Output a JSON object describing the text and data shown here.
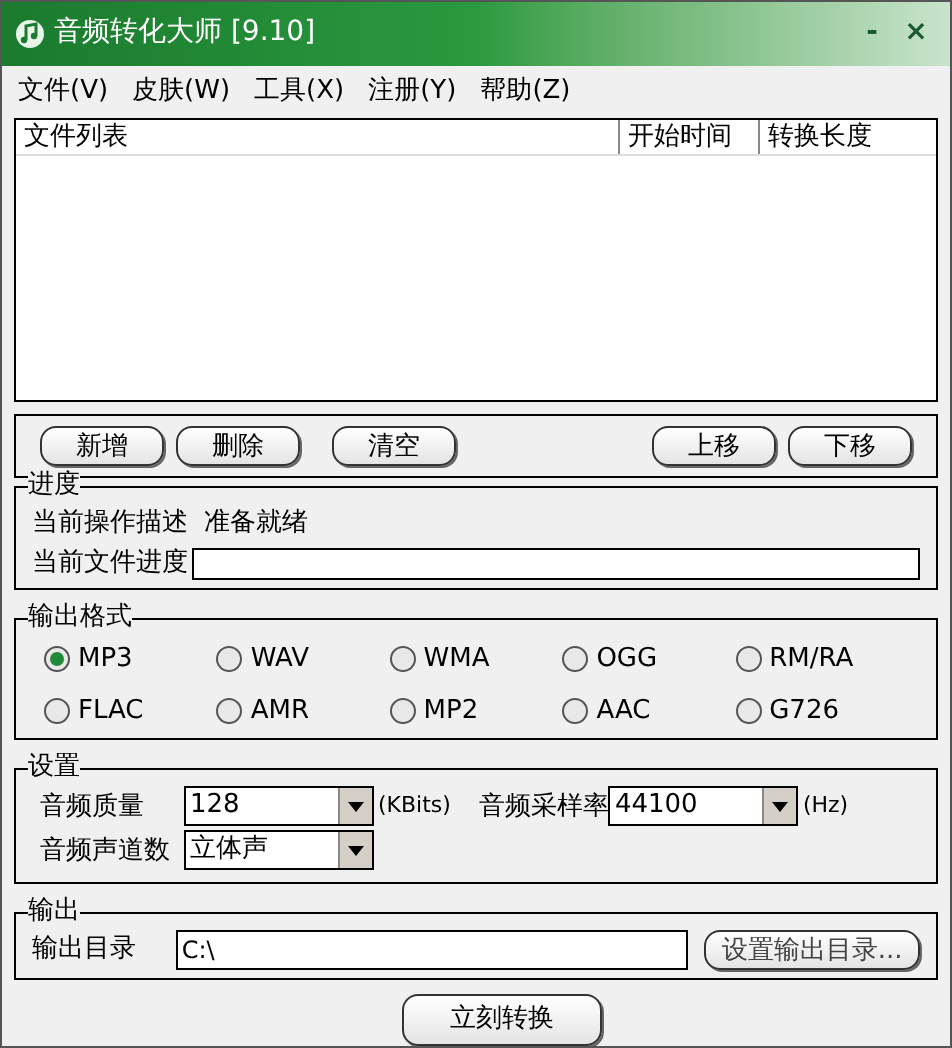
{
  "window": {
    "title": "音频转化大师 [9.10]",
    "controls": [
      "-",
      "×"
    ]
  },
  "menu": [
    "文件(V)",
    "皮肤(W)",
    "工具(X)",
    "注册(Y)",
    "帮助(Z)"
  ],
  "file_list": {
    "columns": [
      "文件列表",
      "开始时间",
      "转换长度"
    ]
  },
  "list_buttons": [
    {
      "label": "新增",
      "kind": "left"
    },
    {
      "label": "删除",
      "kind": "left"
    },
    {
      "label": "清空",
      "kind": "left"
    },
    {
      "label": "上移",
      "kind": "right"
    },
    {
      "label": "下移",
      "kind": "right"
    }
  ],
  "progress": {
    "title": "进度",
    "operation_label": "当前操作描述",
    "operation_value": "准备就绪",
    "file_progress_label": "当前文件进度",
    "level": 0
  },
  "output_format": {
    "title": "输出格式",
    "options": [
      {
        "label": "MP3",
        "selected": true
      },
      {
        "label": "WAV",
        "selected": false
      },
      {
        "label": "WMA",
        "selected": false
      },
      {
        "label": "OGG",
        "selected": false
      },
      {
        "label": "RM/RA",
        "selected": false
      },
      {
        "label": "FLAC",
        "selected": false
      },
      {
        "label": "AMR",
        "selected": false
      },
      {
        "label": "MP2",
        "selected": false
      },
      {
        "label": "AAC",
        "selected": false
      },
      {
        "label": "G726",
        "selected": false
      }
    ]
  },
  "settings": {
    "title": "设置",
    "quality_label": "音频质量",
    "quality_value": "128",
    "quality_unit": "(KBits)",
    "rate_label": "音频采样率",
    "rate_value": "44100",
    "rate_unit": "(Hz)",
    "channels_label": "音频声道数",
    "channels_value": "立体声"
  },
  "output": {
    "title": "输出",
    "dir_label": "输出目录",
    "dir_value": "C:\\",
    "dir_button": "设置输出目录..."
  },
  "convert_button": "立刻转换"
}
